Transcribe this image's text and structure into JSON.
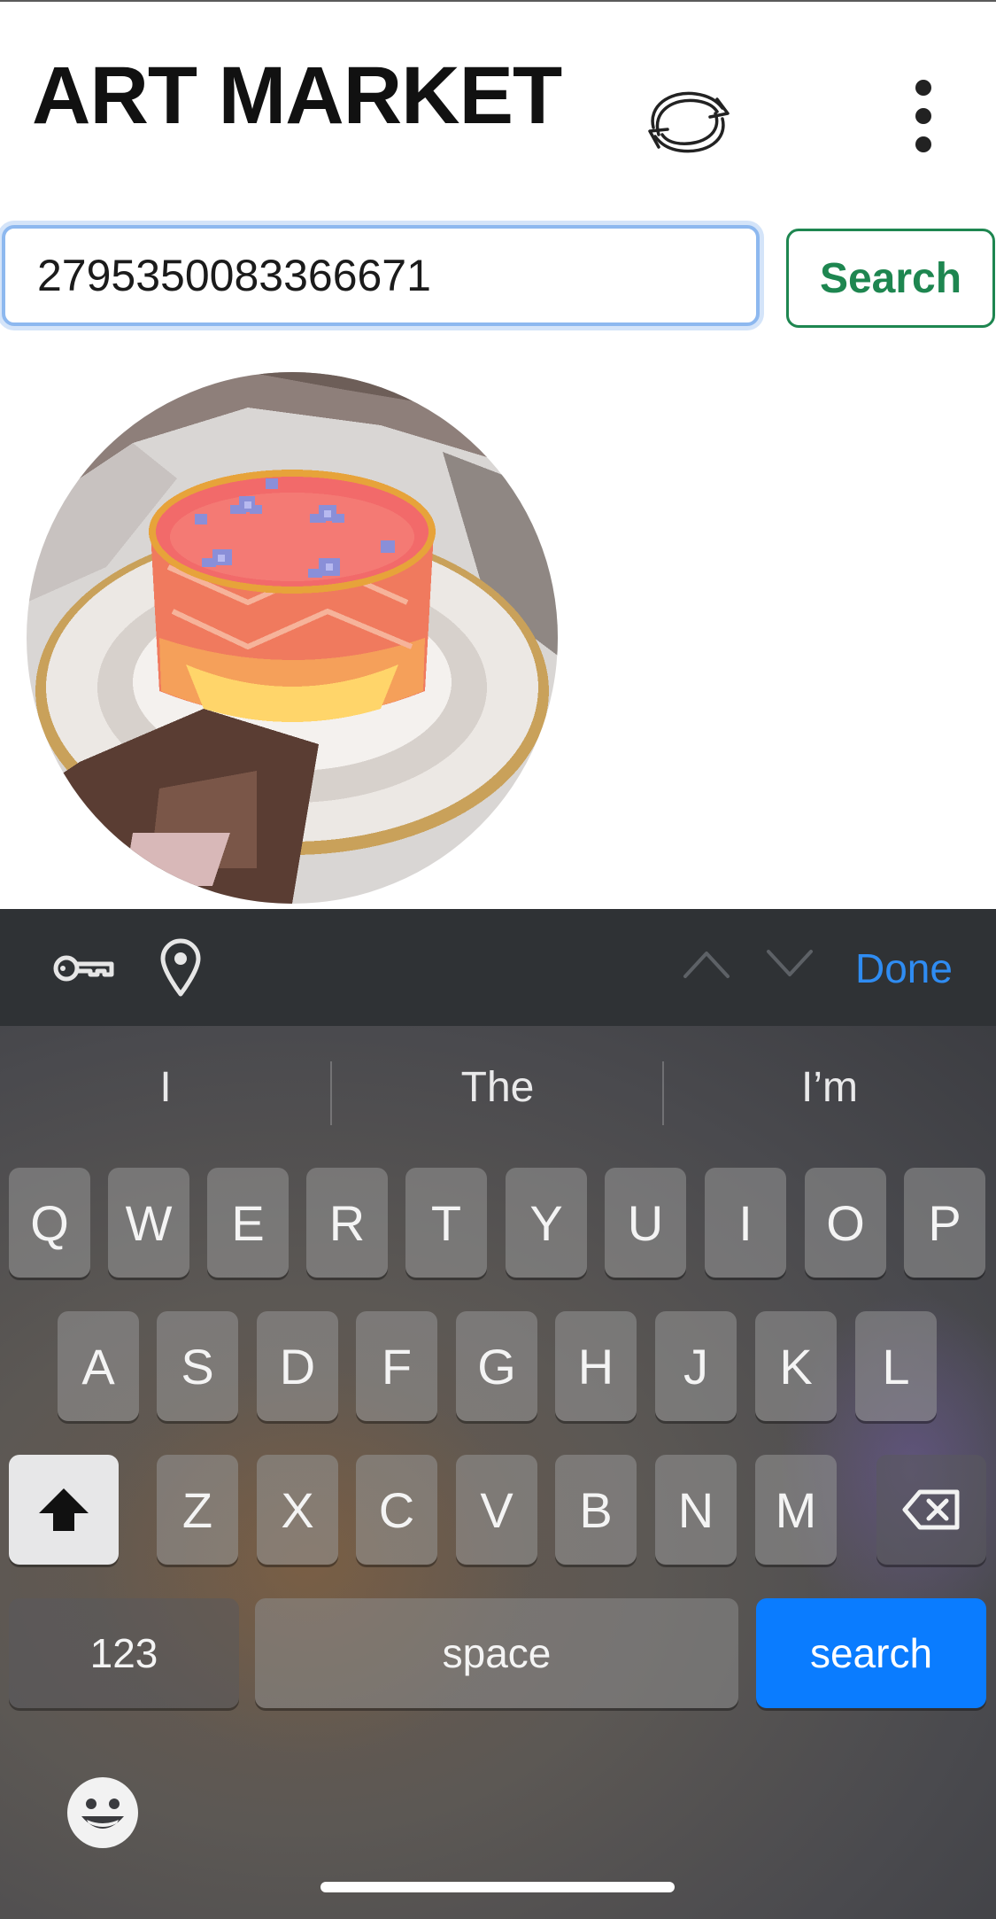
{
  "header": {
    "title": "ART MARKET",
    "refresh_icon": "refresh-cycle-icon",
    "more_icon": "vertical-ellipsis-icon"
  },
  "search": {
    "value": "2795350083366671",
    "button_label": "Search"
  },
  "artwork": {
    "subject": "pixel-art glass of pink drink with purple flowers on a saucer"
  },
  "accessory_bar": {
    "key_icon": "key-icon",
    "location_icon": "location-pin-icon",
    "prev_icon": "chevron-up-icon",
    "next_icon": "chevron-down-icon",
    "done_label": "Done"
  },
  "keyboard": {
    "suggestions": [
      "I",
      "The",
      "I’m"
    ],
    "row1": [
      "Q",
      "W",
      "E",
      "R",
      "T",
      "Y",
      "U",
      "I",
      "O",
      "P"
    ],
    "row2": [
      "A",
      "S",
      "D",
      "F",
      "G",
      "H",
      "J",
      "K",
      "L"
    ],
    "row3": [
      "Z",
      "X",
      "C",
      "V",
      "B",
      "N",
      "M"
    ],
    "shift_icon": "shift-arrow-icon",
    "delete_icon": "backspace-icon",
    "numbers_label": "123",
    "space_label": "space",
    "search_label": "search",
    "emoji_icon": "emoji-smiley-icon"
  },
  "colors": {
    "accent_green": "#1e8650",
    "focus_blue": "#8db8ef",
    "keyboard_blue": "#0a7cff",
    "done_blue": "#2f8cf2"
  }
}
